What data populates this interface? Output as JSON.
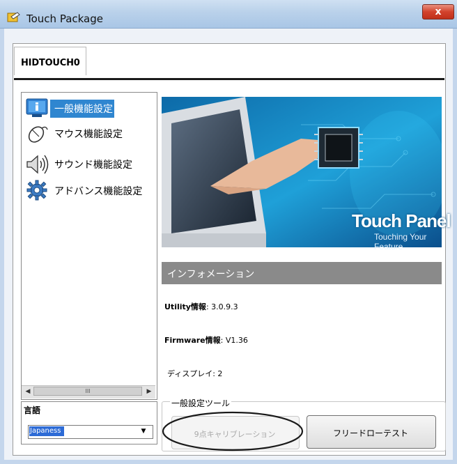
{
  "window": {
    "title": "Touch Package",
    "close_glyph": "x"
  },
  "tabs": [
    {
      "label": "HIDTOUCH0",
      "selected": true
    }
  ],
  "nav": {
    "items": [
      {
        "label": "一般機能設定",
        "icon": "info-icon",
        "selected": true
      },
      {
        "label": "マウス機能設定",
        "icon": "mouse-icon",
        "selected": false
      },
      {
        "label": "サウンド機能設定",
        "icon": "speaker-icon",
        "selected": false
      },
      {
        "label": "アドバンス機能設定",
        "icon": "gear-icon",
        "selected": false
      }
    ],
    "scroll_grip": "III"
  },
  "language": {
    "label": "言語",
    "value": "Japaness"
  },
  "banner": {
    "title": "Touch Panel",
    "subtitle": "Touching Your Feature"
  },
  "info": {
    "header": "インフォメーション",
    "utility_label": "Utility情報",
    "utility_value": ": 3.0.9.3",
    "firmware_label": "Firmware情報",
    "firmware_value": ": V1.36",
    "display_label": "ディスプレイ",
    "display_value": ": 2"
  },
  "tools": {
    "legend": "一般設定ツール",
    "calibration_button": "9点キャリブレーション",
    "calibration_enabled": false,
    "draw_test_button": "フリードローテスト"
  },
  "colors": {
    "selection": "#2f86d0",
    "info_header": "#8a8a8a",
    "close_button": "#d2422c"
  }
}
